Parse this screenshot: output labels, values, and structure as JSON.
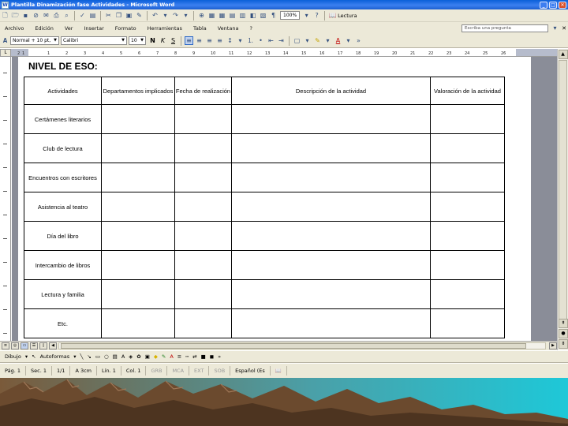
{
  "window": {
    "title": "Plantilla Dinamización fase Actividades - Microsoft Word"
  },
  "menu": {
    "items": [
      "Archivo",
      "Edición",
      "Ver",
      "Insertar",
      "Formato",
      "Herramientas",
      "Tabla",
      "Ventana",
      "?"
    ],
    "help_placeholder": "Escriba una pregunta"
  },
  "toolbar_std": {
    "icons": [
      "new-icon",
      "open-icon",
      "save-icon",
      "permission-icon",
      "email-icon",
      "print-icon",
      "print-preview-icon",
      "spelling-icon",
      "research-icon",
      "cut-icon",
      "copy-icon",
      "paste-icon",
      "format-painter-icon",
      "undo-icon",
      "redo-icon",
      "hyperlink-icon",
      "tables-borders-icon",
      "insert-table-icon",
      "insert-excel-icon",
      "columns-icon",
      "drawing-icon",
      "document-map-icon",
      "show-hide-icon"
    ],
    "zoom": "100%",
    "read_label": "Lectura"
  },
  "toolbar_fmt": {
    "style": "Normal + 10 pt,",
    "font": "Calibri",
    "size": "10",
    "bold": "N",
    "italic": "K",
    "underline": "S"
  },
  "ruler": {
    "numbers": [
      "2",
      "1",
      "1",
      "2",
      "3",
      "4",
      "5",
      "6",
      "7",
      "8",
      "9",
      "10",
      "11",
      "12",
      "13",
      "14",
      "15",
      "16",
      "17",
      "18",
      "19",
      "20",
      "21",
      "22",
      "23",
      "24",
      "25",
      "26"
    ]
  },
  "document": {
    "heading": "NIVEL DE ESO:",
    "columns": [
      "Actividades",
      "Departamentos implicados",
      "Fecha de realización",
      "Descripción de la actividad",
      "Valoración de la actividad"
    ],
    "rows": [
      "Certámenes literarios",
      "Club de lectura",
      "Encuentros con escritores",
      "Asistencia al teatro",
      "Día del libro",
      "Intercambio de libros",
      "Lectura y familia",
      "Etc."
    ]
  },
  "drawing_bar": {
    "draw_label": "Dibujo",
    "autoshapes_label": "Autoformas"
  },
  "statusbar": {
    "page": "Pág. 1",
    "section": "Sec. 1",
    "pages": "1/1",
    "position": "A 3cm",
    "line": "Lín. 1",
    "column": "Col. 1",
    "modes": [
      "GRB",
      "MCA",
      "EXT",
      "SOB"
    ],
    "language": "Español (Es"
  },
  "colors": {
    "title_bar": "#1c5fd0",
    "chrome": "#ece9d8",
    "workspace": "#8a8d98",
    "landscape_sky": "#1ec8d8",
    "landscape_mountain": "#6b4a2e"
  }
}
